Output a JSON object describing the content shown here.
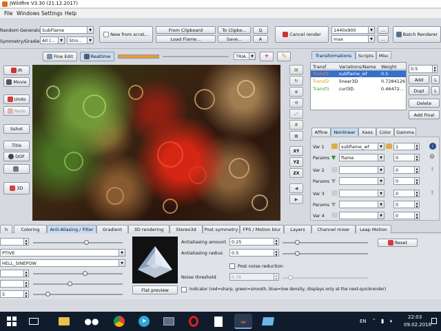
{
  "window": {
    "title": "JWildfire V3.30 (21.12.2017)"
  },
  "menu": [
    "File",
    "Windows",
    "Settings",
    "Help"
  ],
  "top": {
    "random_generator_label": "Random Generator",
    "random_generator_value": "SubFlame",
    "gradient_label": "Symmetry/Gradient",
    "symmetry_value": "All (...",
    "gradient_value": "Stro...",
    "new_from_scratch": "New from scrat...",
    "from_clipboard": "From Clipboard",
    "load_flame": "Load Flame...",
    "to_clipboard": "To Clipbo...",
    "save": "Save...",
    "q_btn": "Q",
    "a_btn": "A",
    "cancel_render": "Cancel render",
    "resolution": "1440x900",
    "quality": "max",
    "more1": "...",
    "more2": "...",
    "batch_renderer": "Batch Renderer"
  },
  "preview_bar": {
    "fine_edit": "Fine Edit",
    "realtime": "Realtime",
    "triangle_mode": "TRIA..."
  },
  "left_tools": {
    "ir": "IR",
    "movie": "Movie",
    "undo": "Undo",
    "redo": "Redo",
    "sshot": "Sshot",
    "title": "Title",
    "dof": "DOF",
    "three_d": "3D"
  },
  "right_tools": {
    "xy": "XY",
    "yz": "YZ",
    "zx": "ZX"
  },
  "right_tabs": [
    "Transformations",
    "Scripts",
    "Misc"
  ],
  "transforms": {
    "headers": [
      "Transf",
      "Variations/Name",
      "Weight"
    ],
    "rows": [
      {
        "transf": "Transf1",
        "name": "subflame_wf",
        "weight": "0.5"
      },
      {
        "transf": "Transf2",
        "name": "linear3D",
        "weight": "0.7284126"
      },
      {
        "transf": "Transf3",
        "name": "curl3D",
        "weight": "0.46472..."
      }
    ],
    "value_field": "0.5",
    "add": "Add",
    "dupl": "Dupl",
    "delete": "Delete",
    "add_final": "Add Final",
    "l_btn": "L",
    "l_btn2": "L"
  },
  "sub_tabs": [
    "Affine",
    "Nonlinear",
    "Xaos",
    "Color",
    "Gamma"
  ],
  "nonlinear": [
    {
      "label": "Var 1",
      "var": "subflame_wf",
      "value": "1",
      "params_label": "Params",
      "param": "flame",
      "param_value": "0"
    },
    {
      "label": "Var 2",
      "var": "",
      "value": "0",
      "params_label": "Params",
      "param": "",
      "param_value": "0"
    },
    {
      "label": "Var 3",
      "var": "",
      "value": "0",
      "params_label": "Params",
      "param": "",
      "param_value": "0"
    },
    {
      "label": "Var 4",
      "var": "",
      "value": "0"
    }
  ],
  "bottom_tabs": [
    "h",
    "Coloring",
    "Anti-Aliasing / Filter",
    "Gradient",
    "3D rendering",
    "Stereo3d",
    "Post symmetry",
    "FPS / Motion blur",
    "Layers",
    "Channel mixer",
    "Leap Motion"
  ],
  "bottom": {
    "field1": "",
    "combo1": "PTIVE",
    "combo2": "HELL_SINEPOW",
    "field2": "",
    "field3": "",
    "field4": "5",
    "flat_preview": "Flat preview",
    "aa_amount_label": "Antialiasing amount",
    "aa_amount": "0.25",
    "aa_radius_label": "Antialiasing radius",
    "aa_radius": "0.5",
    "post_noise_label": "Post noise reduction",
    "noise_threshold_label": "Noise threshold",
    "noise_threshold": "0.35",
    "indicator_label": "Indicator (red=sharp, green=smooth, blue=low density, displays only at the next-quickrender)",
    "reset": "Reset"
  },
  "taskbar": {
    "lang": "EN",
    "time": "22:03",
    "date": "09.02.2018"
  },
  "colors": {
    "accent": "#c8dcf2",
    "taskbar": "#0f1a2a",
    "preview_bg": "#2a1a0f"
  }
}
